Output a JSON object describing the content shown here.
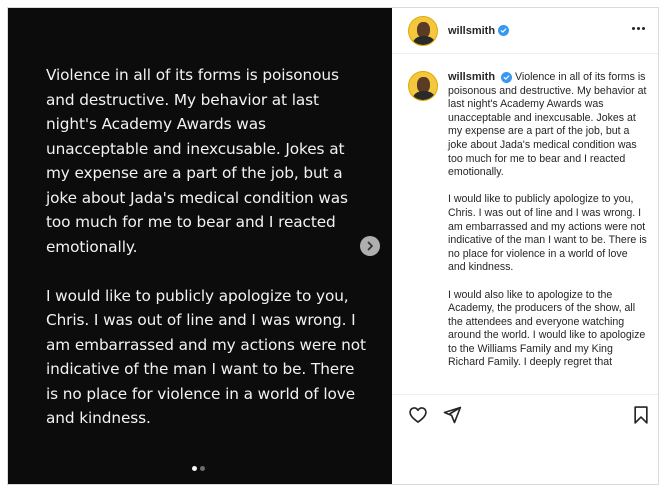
{
  "media": {
    "paragraphs": [
      "Violence in all of its forms is poisonous and destructive. My behavior at last night's Academy Awards was unacceptable and inexcusable. Jokes at my expense are a part of the job, but a joke about Jada's medical condition was too much for me to bear and I reacted emotionally.",
      "I would like to publicly apologize to you, Chris. I was out of line and I was wrong. I am embarrassed and my actions were not indicative of the man I want to be. There is no place for violence in a world of love and kindness."
    ],
    "slide_count": 2,
    "current_slide": 1
  },
  "header": {
    "username": "willsmith"
  },
  "caption": {
    "username": "willsmith",
    "paragraphs": [
      "Violence in all of its forms is poisonous and destructive. My behavior at last night's Academy Awards was unacceptable and inexcusable. Jokes at my expense are a part of the job, but a joke about Jada's medical condition was too much for me to bear and I reacted emotionally.",
      "I would like to publicly apologize to you, Chris. I was out of line and I was wrong. I am embarrassed and my actions were not indicative of the man I want to be. There is no place for violence in a world of love and kindness.",
      "I would also like to apologize to the Academy, the producers of the show, all the attendees and everyone watching around the world. I would like to apologize to the Williams Family and my King Richard Family. I deeply regret that"
    ]
  },
  "icons": {
    "like": "heart-icon",
    "share": "paper-plane-icon",
    "save": "bookmark-icon",
    "more": "more-horizontal-icon",
    "next": "chevron-right-icon",
    "verified": "verified-badge-icon"
  },
  "colors": {
    "verified": "#3897f0",
    "media_background": "#0c0c0c",
    "text": "#262626"
  }
}
